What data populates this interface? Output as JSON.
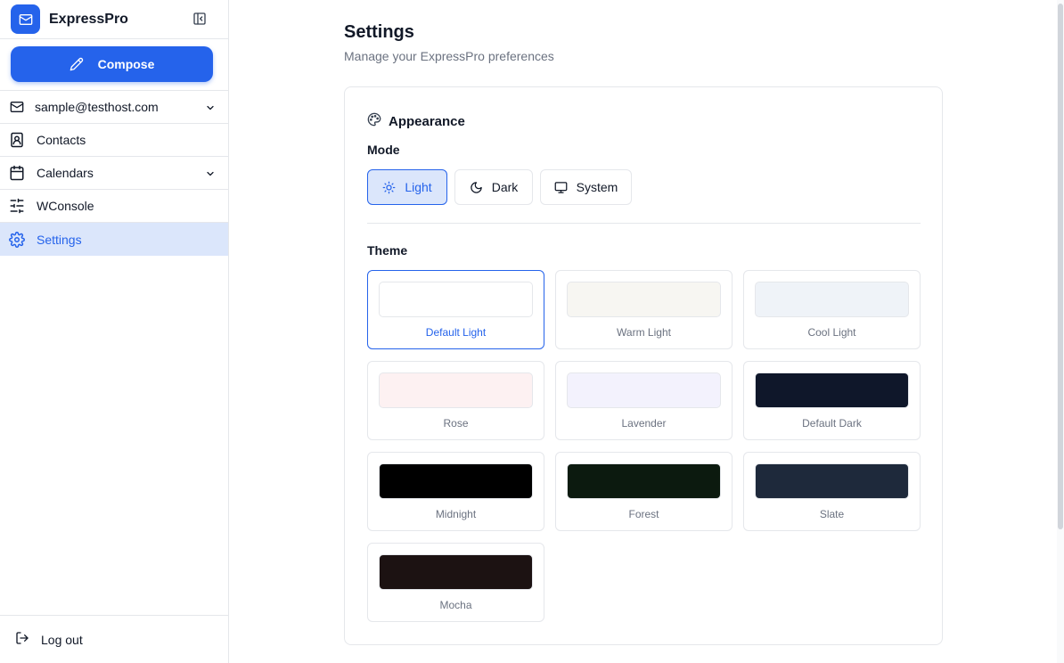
{
  "app": {
    "name": "ExpressPro"
  },
  "sidebar": {
    "compose_label": "Compose",
    "account": "sample@testhost.com",
    "items": [
      {
        "label": "Contacts",
        "icon": "contacts-icon"
      },
      {
        "label": "Calendars",
        "icon": "calendar-icon"
      },
      {
        "label": "WConsole",
        "icon": "sliders-icon"
      },
      {
        "label": "Settings",
        "icon": "gear-icon"
      }
    ],
    "logout_label": "Log out"
  },
  "page": {
    "title": "Settings",
    "subtitle": "Manage your ExpressPro preferences"
  },
  "appearance": {
    "heading": "Appearance",
    "mode_label": "Mode",
    "modes": [
      {
        "label": "Light",
        "icon": "sun-icon",
        "active": true
      },
      {
        "label": "Dark",
        "icon": "moon-icon",
        "active": false
      },
      {
        "label": "System",
        "icon": "monitor-icon",
        "active": false
      }
    ],
    "theme_label": "Theme",
    "themes": [
      {
        "name": "Default Light",
        "color": "#ffffff",
        "selected": true
      },
      {
        "name": "Warm Light",
        "color": "#f7f6f2",
        "selected": false
      },
      {
        "name": "Cool Light",
        "color": "#eff3f8",
        "selected": false
      },
      {
        "name": "Rose",
        "color": "#fdf1f2",
        "selected": false
      },
      {
        "name": "Lavender",
        "color": "#f3f2fd",
        "selected": false
      },
      {
        "name": "Default Dark",
        "color": "#0f172a",
        "selected": false
      },
      {
        "name": "Midnight",
        "color": "#000000",
        "selected": false
      },
      {
        "name": "Forest",
        "color": "#0c1a0f",
        "selected": false
      },
      {
        "name": "Slate",
        "color": "#1e293b",
        "selected": false
      },
      {
        "name": "Mocha",
        "color": "#1c1212",
        "selected": false
      }
    ]
  },
  "colors": {
    "accent": "#2563eb",
    "accent_soft": "#dbe6fb"
  }
}
